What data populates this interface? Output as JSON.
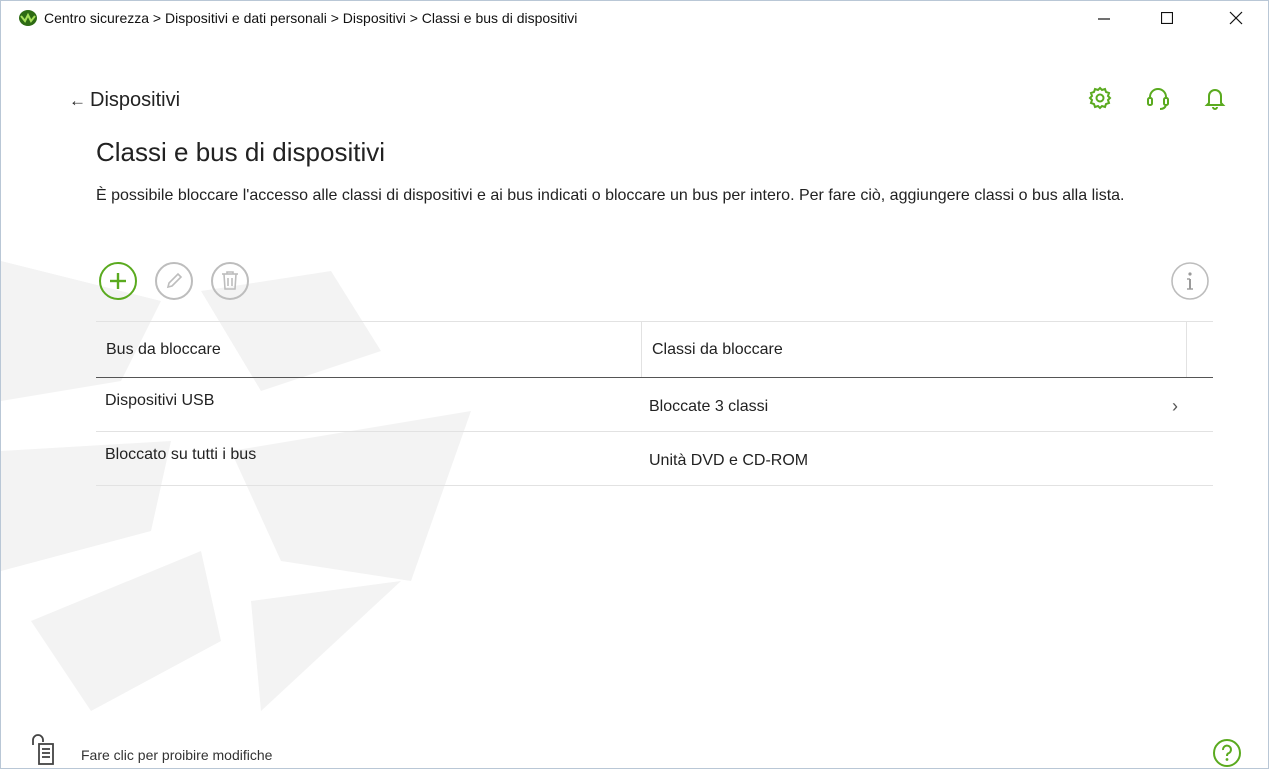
{
  "window": {
    "breadcrumb": "Centro sicurezza > Dispositivi e dati personali > Dispositivi > Classi e bus di dispositivi"
  },
  "nav": {
    "back_arrow": "←",
    "back_label": "Dispositivi"
  },
  "header_icons": [
    "gear-icon",
    "headset-icon",
    "bell-icon"
  ],
  "page": {
    "title": "Classi e bus di dispositivi",
    "description": "È possibile bloccare l'accesso alle classi di dispositivi e ai bus indicati o bloccare un bus per intero. Per fare ciò, aggiungere classi o bus alla lista."
  },
  "toolbar": {
    "add": "plus-circle-icon",
    "edit": "pencil-circle-icon",
    "delete": "trash-circle-icon",
    "info": "info-circle-icon"
  },
  "table": {
    "columns": [
      "Bus da bloccare",
      "Classi da bloccare"
    ],
    "rows": [
      {
        "bus": "Dispositivi USB",
        "classes": "Bloccate 3 classi",
        "expandable": true
      },
      {
        "bus": "Bloccato su tutti i bus",
        "classes": "Unità DVD e CD-ROM",
        "expandable": false
      }
    ],
    "chevron": "›"
  },
  "footer": {
    "lock_text": "Fare clic per proibire modifiche"
  },
  "colors": {
    "accent": "#5aaa1f",
    "disabled": "#bdbdbd"
  }
}
